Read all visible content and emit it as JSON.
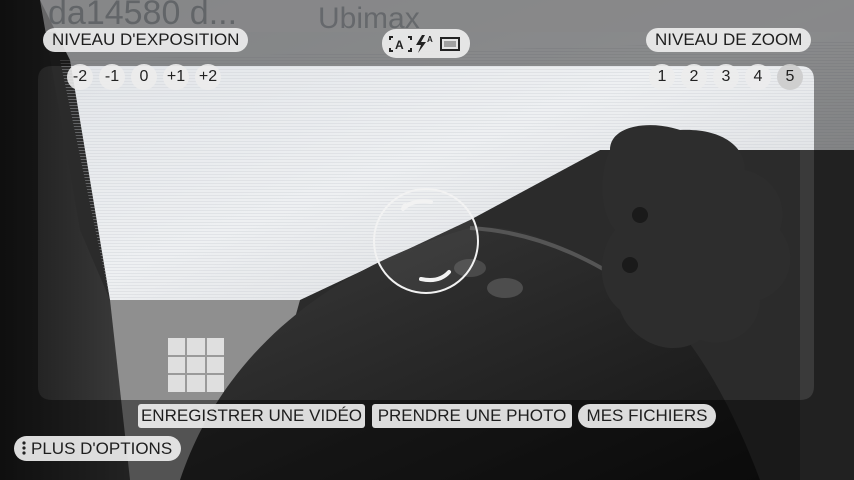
{
  "viewfinder": {
    "background_text_1": "da14580 d...",
    "background_text_2": "Ubimax"
  },
  "exposure": {
    "label": "NIVEAU D'EXPOSITION",
    "levels": [
      "-2",
      "-1",
      "0",
      "+1",
      "+2"
    ]
  },
  "status_icons": [
    "auto-exposure-icon",
    "flash-auto-icon",
    "aspect-ratio-icon"
  ],
  "zoom": {
    "label": "NIVEAU DE ZOOM",
    "levels": [
      "1",
      "2",
      "3",
      "4",
      "5"
    ],
    "selected": "5"
  },
  "actions": {
    "record_video": "ENREGISTRER UNE VIDÉO",
    "take_photo": "PRENDRE UNE PHOTO",
    "my_files": "MES FICHIERS"
  },
  "more_options": {
    "label": "PLUS D'OPTIONS"
  },
  "colors": {
    "pill_bg": "#ececec",
    "text": "#1e1e1e"
  }
}
